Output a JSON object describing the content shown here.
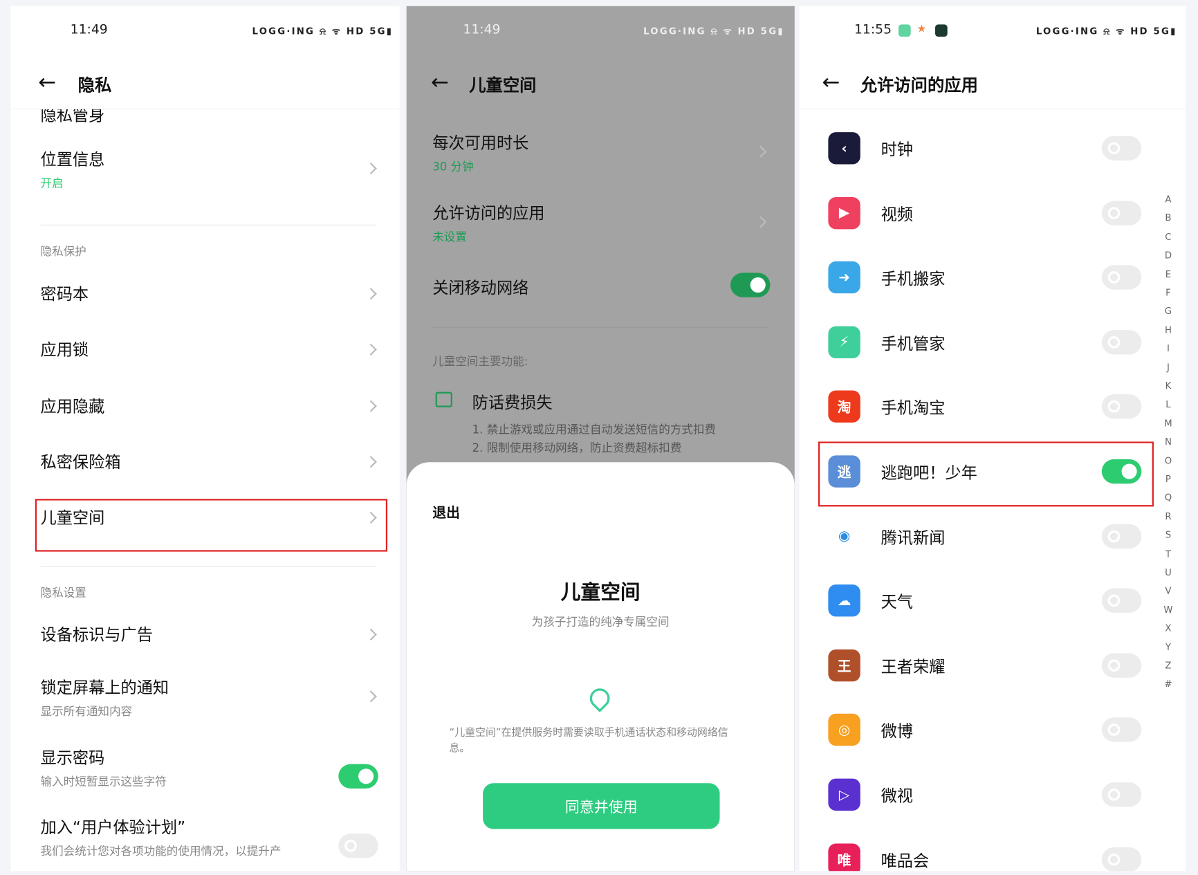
{
  "colors": {
    "accent": "#2ecc71",
    "highlight": "#e02020",
    "overlay": "#a3a3a3"
  },
  "left": {
    "status_time": "11:49",
    "status_icons": "LOGG·ING ⍾ ᯤ HD 5G▮",
    "title": "隐私",
    "clipped_item": "隐私管身",
    "items": [
      {
        "label": "位置信息",
        "sub": "开启"
      },
      {
        "section": "隐私保护"
      },
      {
        "label": "密码本"
      },
      {
        "label": "应用锁"
      },
      {
        "label": "应用隐藏"
      },
      {
        "label": "私密保险箱"
      },
      {
        "label": "儿童空间"
      },
      {
        "section": "隐私设置"
      },
      {
        "label": "设备标识与广告"
      },
      {
        "label": "锁定屏幕上的通知",
        "sub": "显示所有通知内容"
      },
      {
        "label": "显示密码",
        "sub": "输入时短暂显示这些字符",
        "toggle": true
      },
      {
        "label": "加入“用户体验计划”",
        "sub": "我们会统计您对各项功能的使用情况，以提升产",
        "toggle": false
      }
    ]
  },
  "middle": {
    "status_time": "11:49",
    "status_icons": "LOGG·ING ⍾ ᯤ HD 5G▮",
    "title": "儿童空间",
    "rows": [
      {
        "label": "每次可用时长",
        "sub": "30 分钟"
      },
      {
        "label": "允许访问的应用",
        "sub": "未设置"
      },
      {
        "label": "关闭移动网络",
        "toggle": true
      }
    ],
    "features_heading": "儿童空间主要功能:",
    "feature_title": "防话费损失",
    "feature_lines": [
      "1. 禁止游戏或应用通过自动发送短信的方式扣费",
      "2. 限制使用移动网络，防止资费超标扣费"
    ],
    "sheet": {
      "exit": "退出",
      "heading": "儿童空间",
      "subtitle": "为孩子打造的纯净专属空间",
      "notice": "“儿童空间”在提供服务时需要读取手机通话状态和移动网络信息。",
      "agree_button": "同意并使用"
    }
  },
  "right": {
    "status_time": "11:55",
    "status_icons": "LOGG·ING ⍾ ᯤ HD 5G▮",
    "title": "允许访问的应用",
    "apps": [
      {
        "name": "时钟",
        "on": false,
        "icon": "clock-icon",
        "color": "#1a1a3a",
        "glyph": "‹"
      },
      {
        "name": "视频",
        "on": false,
        "icon": "video-icon",
        "color": "#f04060",
        "glyph": "▶"
      },
      {
        "name": "手机搬家",
        "on": false,
        "icon": "phone-clone-icon",
        "color": "#3aa8e8",
        "glyph": "➜"
      },
      {
        "name": "手机管家",
        "on": false,
        "icon": "phone-manager-icon",
        "color": "#3fcf9a",
        "glyph": "⚡"
      },
      {
        "name": "手机淘宝",
        "on": false,
        "icon": "taobao-icon",
        "color": "#ee3a1c",
        "glyph": "淘"
      },
      {
        "name": "逃跑吧！少年",
        "on": true,
        "icon": "game-icon",
        "color": "#5a8ed8",
        "glyph": "逃"
      },
      {
        "name": "腾讯新闻",
        "on": false,
        "icon": "tencent-news-icon",
        "color": "#ffffff",
        "glyph": "◉"
      },
      {
        "name": "天气",
        "on": false,
        "icon": "weather-icon",
        "color": "#2f8cf0",
        "glyph": "☁"
      },
      {
        "name": "王者荣耀",
        "on": false,
        "icon": "honor-of-kings-icon",
        "color": "#b0502a",
        "glyph": "王"
      },
      {
        "name": "微博",
        "on": false,
        "icon": "weibo-icon",
        "color": "#f8a020",
        "glyph": "◎"
      },
      {
        "name": "微视",
        "on": false,
        "icon": "weishi-icon",
        "color": "#5a30d0",
        "glyph": "▷"
      },
      {
        "name": "唯品会",
        "on": false,
        "icon": "vipshop-icon",
        "color": "#e8205a",
        "glyph": "唯"
      }
    ],
    "alphabet": [
      "A",
      "B",
      "C",
      "D",
      "E",
      "F",
      "G",
      "H",
      "I",
      "J",
      "K",
      "L",
      "M",
      "N",
      "O",
      "P",
      "Q",
      "R",
      "S",
      "T",
      "U",
      "V",
      "W",
      "X",
      "Y",
      "Z",
      "#"
    ]
  }
}
